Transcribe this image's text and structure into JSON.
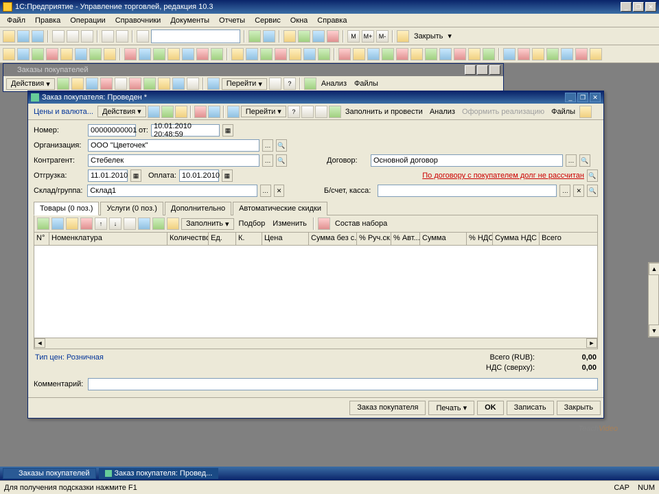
{
  "app": {
    "title": "1С:Предприятие - Управление торговлей, редакция 10.3"
  },
  "menu": [
    "Файл",
    "Правка",
    "Операции",
    "Справочники",
    "Документы",
    "Отчеты",
    "Сервис",
    "Окна",
    "Справка"
  ],
  "toolbar2_close": "Закрыть",
  "bgwin": {
    "title": "Заказы покупателей",
    "actions": "Действия",
    "goto": "Перейти",
    "analysis": "Анализ",
    "files": "Файлы"
  },
  "doc": {
    "title": "Заказ покупателя: Проведен *",
    "bar": {
      "prices": "Цены и валюта...",
      "actions": "Действия",
      "goto": "Перейти",
      "fillpost": "Заполнить и провести",
      "analysis": "Анализ",
      "realize": "Оформить реализацию",
      "files": "Файлы"
    },
    "labels": {
      "number": "Номер:",
      "from": "от:",
      "org": "Организация:",
      "contr": "Контрагент:",
      "ship": "Отгрузка:",
      "pay": "Оплата:",
      "whg": "Склад/группа:",
      "contract": "Договор:",
      "bank": "Б/счет, касса:",
      "comment": "Комментарий:"
    },
    "values": {
      "number": "00000000001",
      "date": "10.01.2010 20:48:59",
      "org": "ООО \"Цветочек\"",
      "contr": "Стебелек",
      "ship": "11.01.2010",
      "pay": "10.01.2010",
      "wh": "Склад1",
      "contract": "Основной договор",
      "bank": "",
      "comment": ""
    },
    "debt_link": "По договору с покупателем долг не рассчитан",
    "tabs": [
      "Товары (0 поз.)",
      "Услуги (0 поз.)",
      "Дополнительно",
      "Автоматические скидки"
    ],
    "subbar": {
      "fill": "Заполнить",
      "select": "Подбор",
      "change": "Изменить",
      "compose": "Состав набора"
    },
    "cols": [
      "N°",
      "Номенклатура",
      "Количество",
      "Ед.",
      "К.",
      "Цена",
      "Сумма без с...",
      "% Руч.ск.",
      "% Авт...",
      "Сумма",
      "% НДС",
      "Сумма НДС",
      "Всего"
    ],
    "price_type": "Тип цен: Розничная",
    "totals": {
      "total_lbl": "Всего (RUB):",
      "total_val": "0,00",
      "vat_lbl": "НДС (сверху):",
      "vat_val": "0,00"
    },
    "buttons": {
      "order": "Заказ покупателя",
      "print": "Печать",
      "ok": "OK",
      "save": "Записать",
      "close": "Закрыть"
    }
  },
  "tasks": [
    "Заказы покупателей",
    "Заказ покупателя: Провед..."
  ],
  "status": {
    "hint": "Для получения подсказки нажмите F1",
    "cap": "CAP",
    "num": "NUM"
  },
  "watermark": {
    "t1": "Teach",
    "t2": "Video"
  }
}
